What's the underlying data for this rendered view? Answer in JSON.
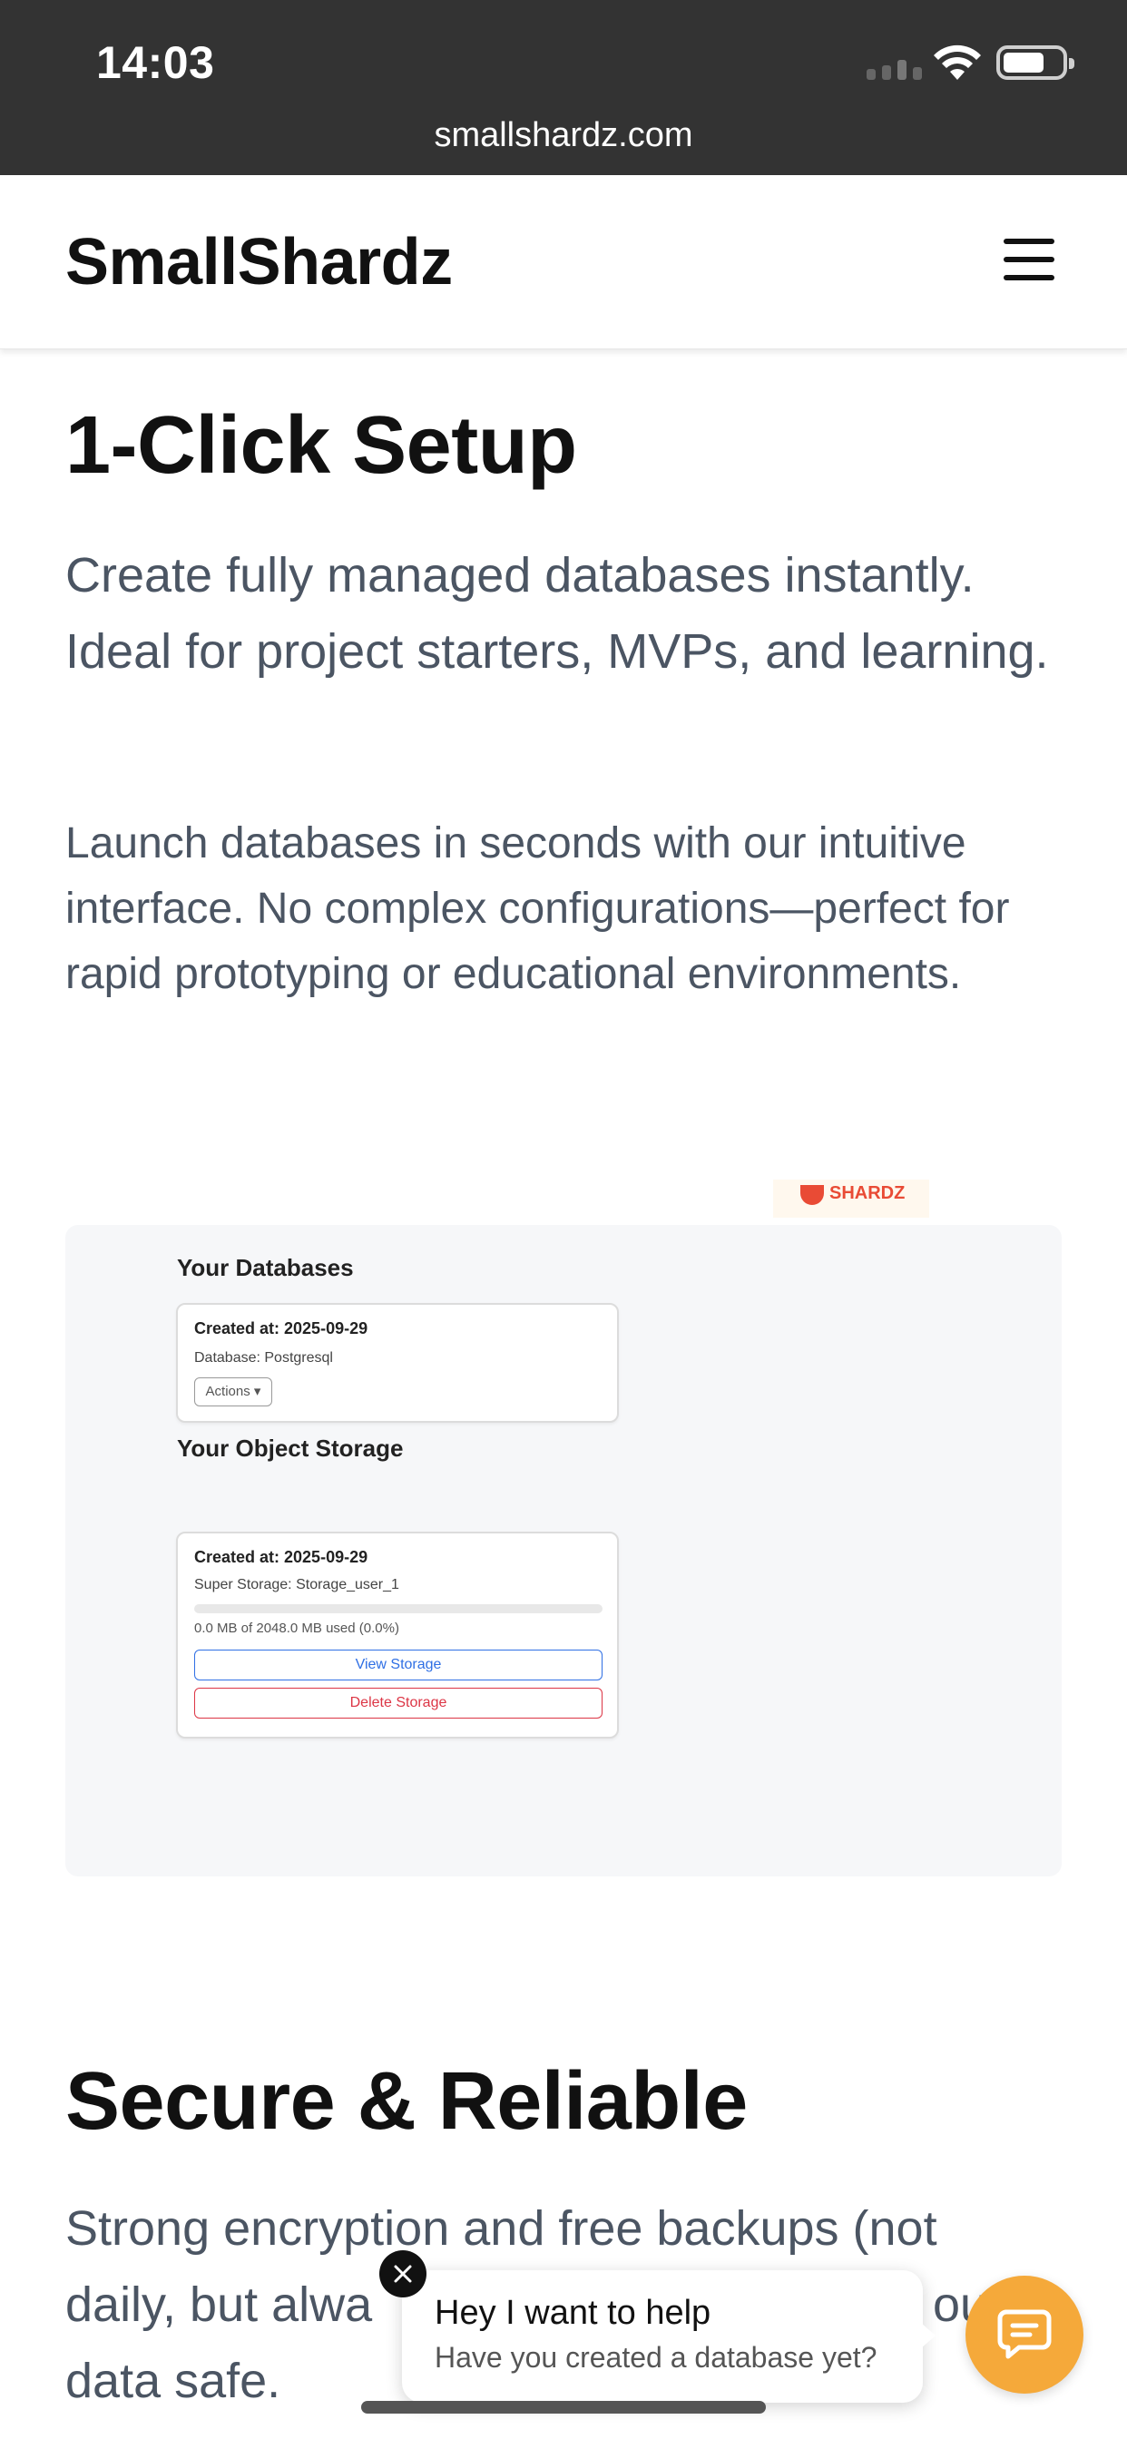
{
  "status_bar": {
    "time": "14:03",
    "url": "smallshardz.com"
  },
  "header": {
    "brand": "SmallShardz",
    "menu_icon": "hamburger-menu-icon"
  },
  "section1": {
    "title": "1-Click Setup",
    "lead": "Create fully managed databases instantly. Ideal for project starters, MVPs, and learning.",
    "body": "Launch databases in seconds with our intuitive interface. No complex configurations—perfect for rapid prototyping or educational environments."
  },
  "preview": {
    "logo_text": "SHARDZ",
    "databases_heading": "Your Databases",
    "database_card": {
      "created": "Created at: 2025-09-29",
      "database": "Database: Postgresql",
      "actions_label": "Actions ▾"
    },
    "storage_heading": "Your Object Storage",
    "storage_card": {
      "created": "Created at: 2025-09-29",
      "name": "Super Storage: Storage_user_1",
      "usage": "0.0 MB of 2048.0 MB used (0.0%)",
      "usage_fraction": 0.0,
      "view_label": "View Storage",
      "delete_label": "Delete Storage"
    }
  },
  "section2": {
    "title": "Secure & Reliable",
    "body_line1": "Strong encryption and free backups (not",
    "body_line2_a": "daily, but alwa",
    "body_line2_b": "our",
    "body_line3": "data safe."
  },
  "chat": {
    "title": "Hey I want to help",
    "subtitle": "Have you created a database yet?",
    "accent_color": "#f5a93a"
  }
}
